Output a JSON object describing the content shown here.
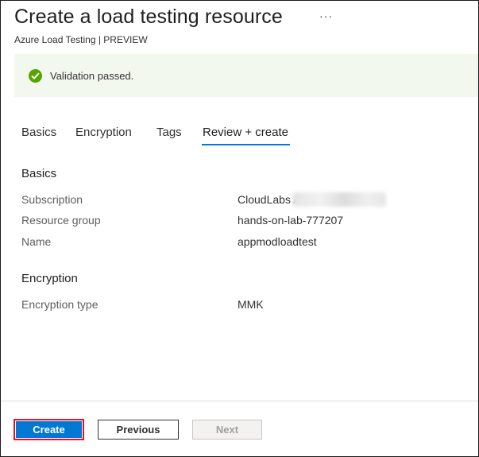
{
  "header": {
    "title": "Create a load testing resource",
    "more_label": "···",
    "subtitle": "Azure Load Testing | PREVIEW"
  },
  "banner": {
    "message": "Validation passed.",
    "icon": "check-circle-icon",
    "color": "#57a300"
  },
  "tabs": [
    {
      "label": "Basics"
    },
    {
      "label": "Encryption"
    },
    {
      "label": "Tags"
    },
    {
      "label": "Review + create",
      "active": true
    }
  ],
  "basics": {
    "heading": "Basics",
    "rows": [
      {
        "label": "Subscription",
        "value": "CloudLabs A"
      },
      {
        "label": "Resource group",
        "value": "hands-on-lab-777207"
      },
      {
        "label": "Name",
        "value": "appmodloadtest"
      }
    ]
  },
  "encryption": {
    "heading": "Encryption",
    "rows": [
      {
        "label": "Encryption type",
        "value": "MMK"
      }
    ]
  },
  "footer": {
    "create_label": "Create",
    "previous_label": "Previous",
    "next_label": "Next"
  },
  "colors": {
    "accent": "#0078d4",
    "highlight_border": "#e81123"
  }
}
